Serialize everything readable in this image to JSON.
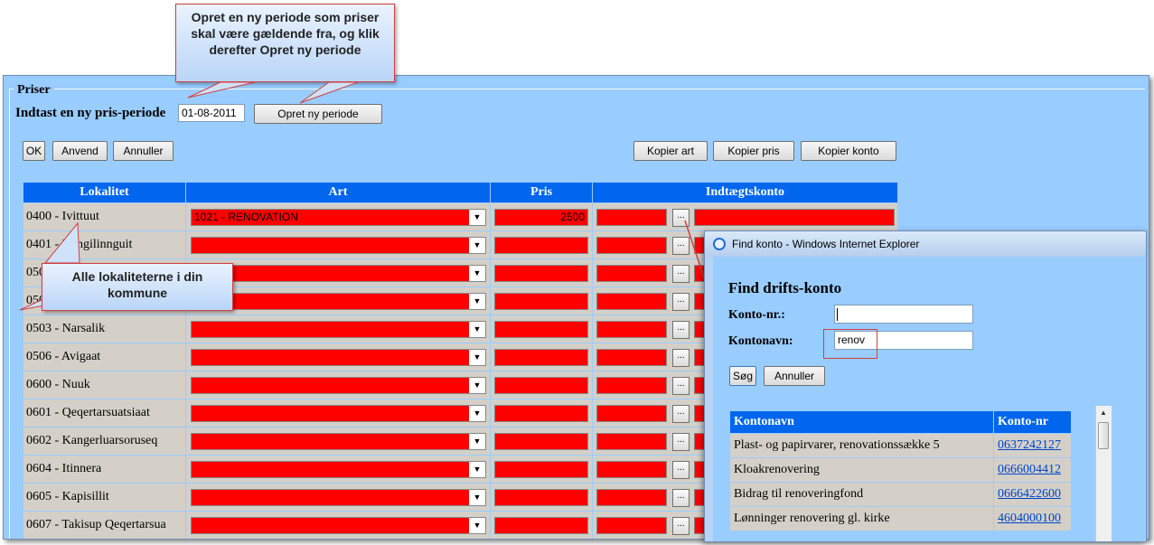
{
  "callouts": {
    "top": "Opret en ny periode som priser skal være gældende fra, og klik derefter Opret ny periode",
    "left": "Alle lokaliteterne i din kommune"
  },
  "priser": {
    "legend": "Priser",
    "period_label": "Indtast en ny pris-periode",
    "period_value": "01-08-2011",
    "create_period_button": "Opret ny periode"
  },
  "toolbar": {
    "ok": "OK",
    "anvend": "Anvend",
    "annuller": "Annuller",
    "kopier_art": "Kopier art",
    "kopier_pris": "Kopier pris",
    "kopier_konto": "Kopier konto"
  },
  "grid": {
    "headers": [
      "Lokalitet",
      "Art",
      "Pris",
      "Indtægtskonto"
    ],
    "rows": [
      {
        "lokalitet": "0400 - Ivittuut",
        "art": "1021 - RENOVATION",
        "pris": "2500"
      },
      {
        "lokalitet": "0401 - Kangilinnguit",
        "art": "",
        "pris": ""
      },
      {
        "lokalitet": "0500 - Paamiut",
        "art": "",
        "pris": ""
      },
      {
        "lokalitet": "0501 - Arsuk",
        "art": "",
        "pris": ""
      },
      {
        "lokalitet": "0503 - Narsalik",
        "art": "",
        "pris": ""
      },
      {
        "lokalitet": "0506 - Avigaat",
        "art": "",
        "pris": ""
      },
      {
        "lokalitet": "0600 - Nuuk",
        "art": "",
        "pris": ""
      },
      {
        "lokalitet": "0601 - Qeqertarsuatsiaat",
        "art": "",
        "pris": ""
      },
      {
        "lokalitet": "0602 - Kangerluarsoruseq",
        "art": "",
        "pris": ""
      },
      {
        "lokalitet": "0604 - Itinnera",
        "art": "",
        "pris": ""
      },
      {
        "lokalitet": "0605 - Kapisillit",
        "art": "",
        "pris": ""
      },
      {
        "lokalitet": "0607 - Takisup Qeqertarsua",
        "art": "",
        "pris": ""
      }
    ],
    "dots_label": "..."
  },
  "popup": {
    "window_title": "Find konto - Windows Internet Explorer",
    "heading": "Find drifts-konto",
    "konto_nr_label": "Konto-nr.:",
    "konto_nr_value": "",
    "kontonavn_label": "Kontonavn:",
    "kontonavn_value": "renov",
    "sog_button": "Søg",
    "annuller_button": "Annuller",
    "results_headers": [
      "Kontonavn",
      "Konto-nr"
    ],
    "results": [
      {
        "navn": "Plast- og papirvarer, renovationssække 5",
        "nr": "0637242127"
      },
      {
        "navn": "Kloakrenovering",
        "nr": "0666004412"
      },
      {
        "navn": "Bidrag til renoveringfond",
        "nr": "0666422600"
      },
      {
        "navn": "Lønninger renovering gl. kirke",
        "nr": "4604000100"
      }
    ]
  },
  "colors": {
    "background": "#99ccff",
    "header": "#0066ee",
    "required_field": "#ff0000",
    "callout_border": "#d04040"
  }
}
